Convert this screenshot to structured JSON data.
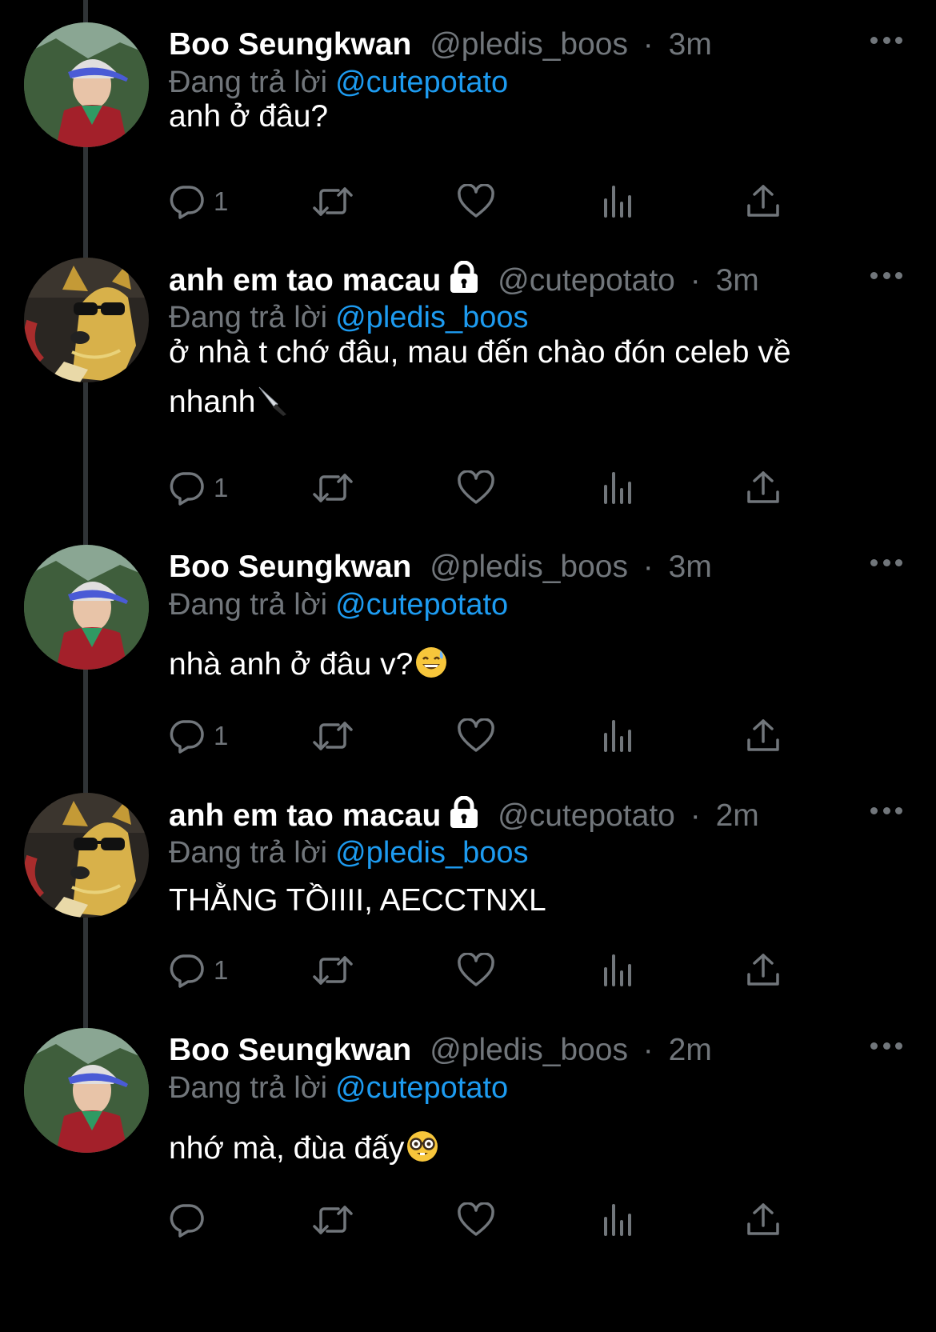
{
  "colors": {
    "background": "#000000",
    "text": "#ffffff",
    "muted": "#71767b",
    "mention": "#1d9bf0",
    "thread_line": "#2f3336"
  },
  "tweets": [
    {
      "name": "Boo Seungkwan",
      "handle": "@pledis_boos",
      "dot": "·",
      "time": "3m",
      "locked": false,
      "reply_prefix": "Đang trả lời",
      "reply_to": "@cutepotato",
      "lines": [
        "anh ở đâu?"
      ],
      "emoji": "",
      "reply_count": "1",
      "avatar": "person-avatar"
    },
    {
      "name": "anh em tao macau",
      "handle": "@cutepotato",
      "dot": "·",
      "time": "3m",
      "locked": true,
      "reply_prefix": "Đang trả lời",
      "reply_to": "@pledis_boos",
      "lines": [
        "ở nhà t chớ đâu, mau đến chào đón celeb về",
        "nhanh"
      ],
      "emoji": "knife-emoji",
      "reply_count": "1",
      "avatar": "dog-avatar"
    },
    {
      "name": "Boo Seungkwan",
      "handle": "@pledis_boos",
      "dot": "·",
      "time": "3m",
      "locked": false,
      "reply_prefix": "Đang trả lời",
      "reply_to": "@cutepotato",
      "lines": [
        "nhà anh ở đâu v?"
      ],
      "emoji": "sweat-smile-emoji",
      "reply_count": "1",
      "avatar": "person-avatar"
    },
    {
      "name": "anh em tao macau",
      "handle": "@cutepotato",
      "dot": "·",
      "time": "2m",
      "locked": true,
      "reply_prefix": "Đang trả lời",
      "reply_to": "@pledis_boos",
      "lines": [
        "THẰNG TỒIIII, AECCTNXL"
      ],
      "emoji": "",
      "reply_count": "1",
      "avatar": "dog-avatar"
    },
    {
      "name": "Boo Seungkwan",
      "handle": "@pledis_boos",
      "dot": "·",
      "time": "2m",
      "locked": false,
      "reply_prefix": "Đang trả lời",
      "reply_to": "@cutepotato",
      "lines": [
        "nhớ mà, đùa đấy"
      ],
      "emoji": "nerd-face-emoji",
      "reply_count": "",
      "avatar": "person-avatar"
    }
  ]
}
